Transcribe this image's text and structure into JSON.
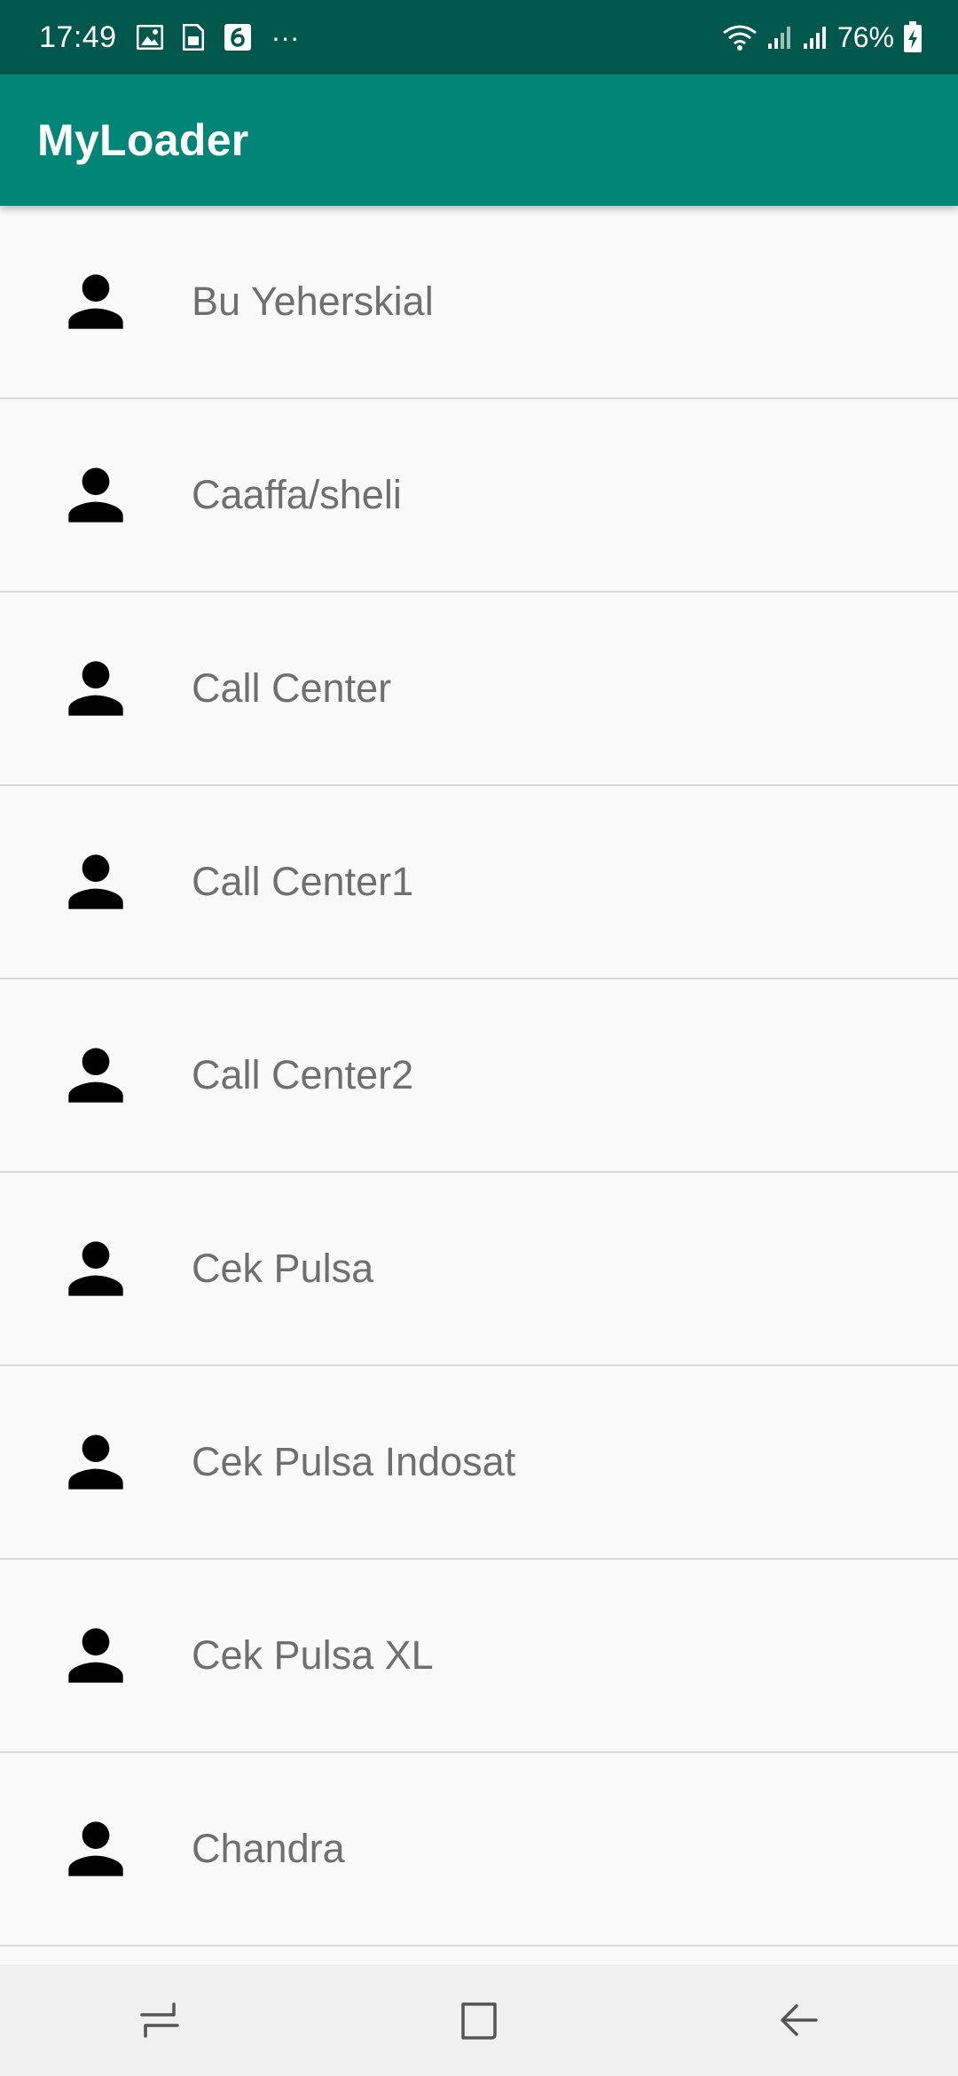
{
  "status_bar": {
    "time": "17:49",
    "battery": "76%",
    "more": "···",
    "icons": [
      "image-icon",
      "sim-icon",
      "app-6-icon",
      "wifi-icon",
      "signal-icon",
      "signal-icon-2",
      "battery-charging-icon"
    ]
  },
  "app_bar": {
    "title": "MyLoader",
    "color": "#008577",
    "status_color": "#00574b"
  },
  "contacts": [
    {
      "name": "Bu Yeherskial",
      "icon": "person-icon"
    },
    {
      "name": "Caaffa/sheli",
      "icon": "person-icon"
    },
    {
      "name": "Call Center",
      "icon": "person-icon"
    },
    {
      "name": "Call Center1",
      "icon": "person-icon"
    },
    {
      "name": "Call Center2",
      "icon": "person-icon"
    },
    {
      "name": "Cek Pulsa",
      "icon": "person-icon"
    },
    {
      "name": "Cek Pulsa Indosat",
      "icon": "person-icon"
    },
    {
      "name": "Cek Pulsa XL",
      "icon": "person-icon"
    },
    {
      "name": "Chandra",
      "icon": "person-icon"
    }
  ],
  "nav_bar": {
    "icons": [
      "recents-icon",
      "home-icon",
      "back-icon"
    ]
  }
}
